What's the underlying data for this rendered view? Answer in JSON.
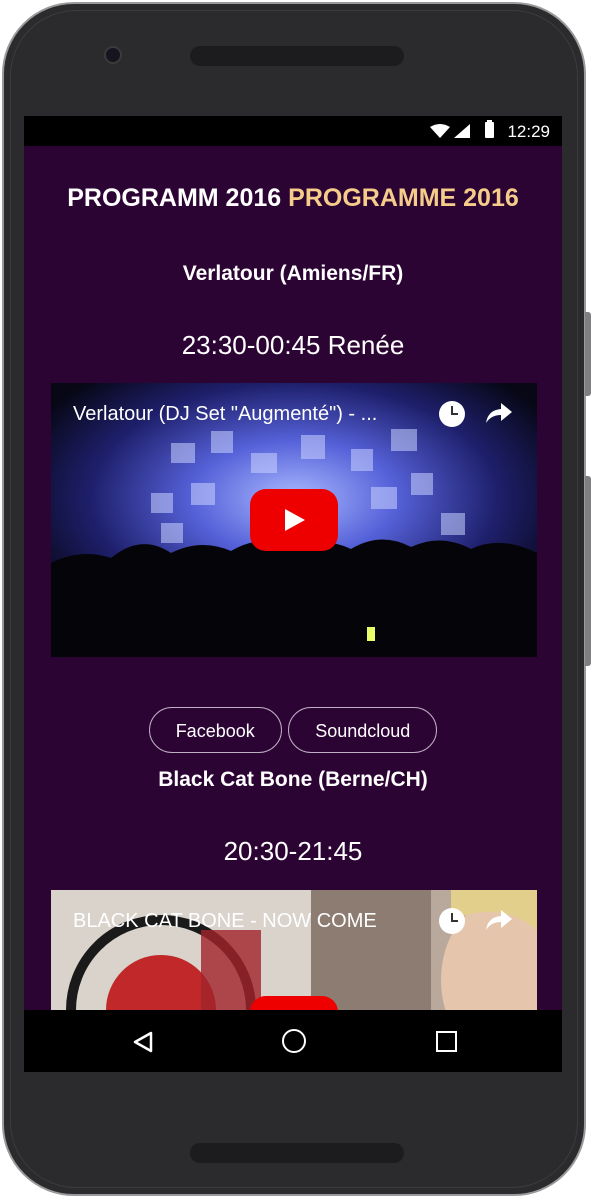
{
  "status": {
    "time": "12:29"
  },
  "page": {
    "title_de": "PROGRAMM 2016",
    "title_fr": "PROGRAMME 2016"
  },
  "acts": [
    {
      "name": "Verlatour (Amiens/FR)",
      "time": "23:30-00:45 Renée",
      "video_title": "Verlatour (DJ Set \"Augmenté\") - ...",
      "links": [
        "Facebook",
        "Soundcloud"
      ]
    },
    {
      "name": "Black Cat Bone (Berne/CH)",
      "time": "20:30-21:45",
      "video_title": "BLACK CAT BONE - NOW COME"
    }
  ],
  "icons": {
    "wifi": "wifi-icon",
    "signal": "signal-icon",
    "battery": "battery-icon",
    "watch_later": "clock-icon",
    "share": "share-icon",
    "play": "youtube-play-icon",
    "back": "back-icon",
    "home": "home-icon",
    "recents": "recents-icon"
  },
  "colors": {
    "background": "#2c0434",
    "title_accent": "#f5cc8a",
    "play_button": "#ee0000"
  }
}
